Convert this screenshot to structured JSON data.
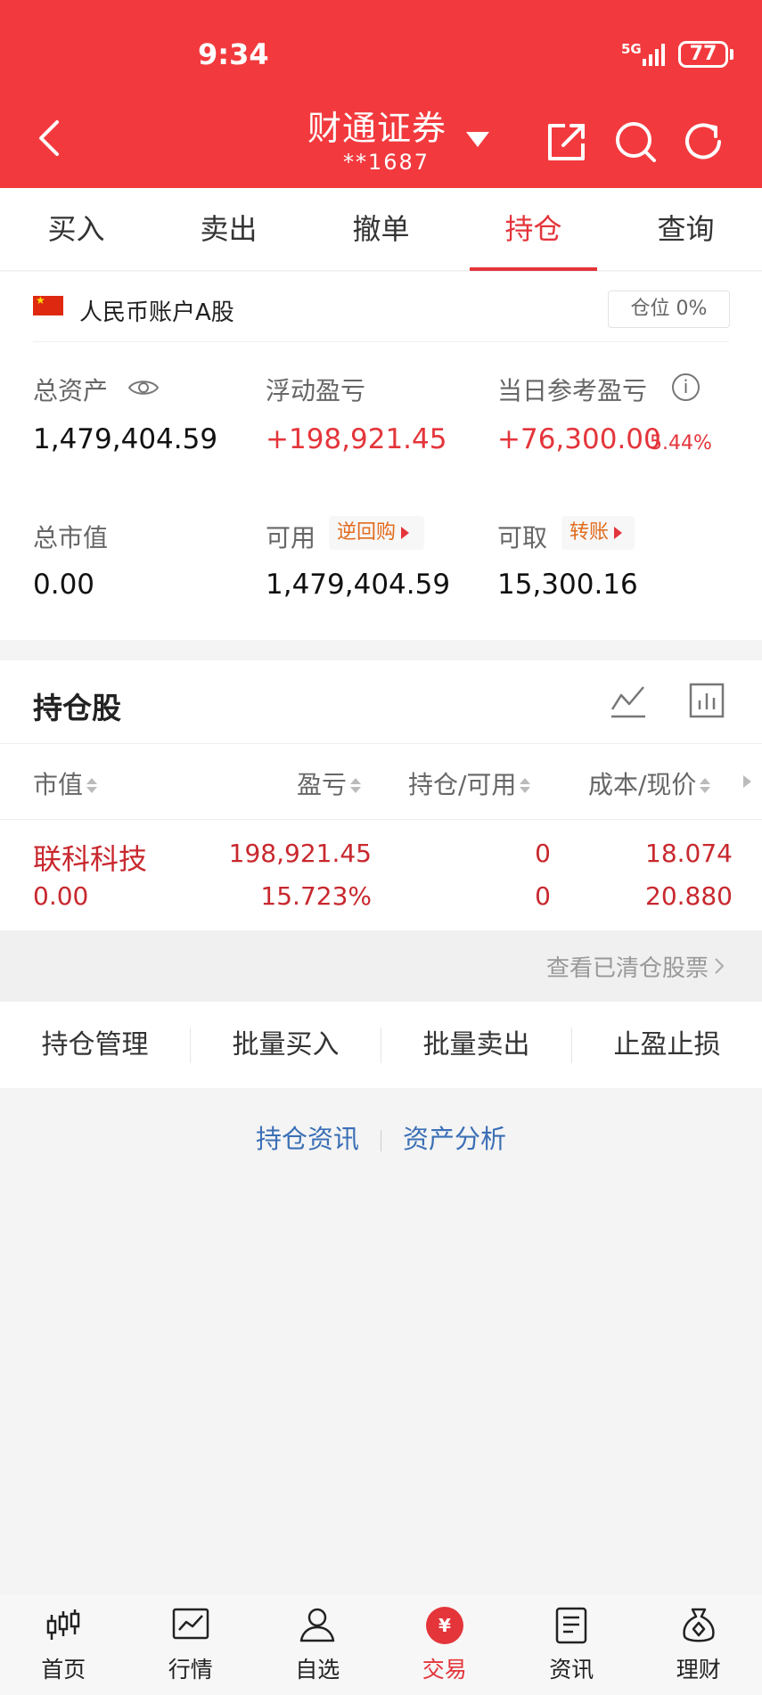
{
  "status_bar": {
    "time": "9:34",
    "network": "5G",
    "battery": "77"
  },
  "header": {
    "broker": "财通证券",
    "account": "**1687"
  },
  "tabs": [
    {
      "label": "买入",
      "active": false
    },
    {
      "label": "卖出",
      "active": false
    },
    {
      "label": "撤单",
      "active": false
    },
    {
      "label": "持仓",
      "active": true
    },
    {
      "label": "查询",
      "active": false
    }
  ],
  "account": {
    "type": "人民币账户A股",
    "position_ratio": "仓位 0%",
    "total_assets_label": "总资产",
    "total_assets": "1,479,404.59",
    "floating_pl_label": "浮动盈亏",
    "floating_pl": "+198,921.45",
    "daily_pl_label": "当日参考盈亏",
    "daily_pl": "+76,300.00",
    "daily_pl_pct": "5.44%",
    "market_value_label": "总市值",
    "market_value": "0.00",
    "available_label": "可用",
    "available_pill": "逆回购",
    "available": "1,479,404.59",
    "withdrawable_label": "可取",
    "withdrawable_pill": "转账",
    "withdrawable": "15,300.16"
  },
  "holdings": {
    "title": "持仓股",
    "columns": [
      "市值",
      "盈亏",
      "持仓/可用",
      "成本/现价"
    ],
    "rows": [
      {
        "name": "联科科技",
        "market_value": "0.00",
        "pl": "198,921.45",
        "pl_pct": "15.723%",
        "position": "0",
        "available": "0",
        "cost": "18.074",
        "price": "20.880"
      }
    ],
    "cleared_link": "查看已清仓股票"
  },
  "actions": [
    "持仓管理",
    "批量买入",
    "批量卖出",
    "止盈止损"
  ],
  "links": [
    "持仓资讯",
    "资产分析"
  ],
  "bottom_nav": [
    {
      "label": "首页",
      "icon": "candlestick-icon"
    },
    {
      "label": "行情",
      "icon": "trend-chart-icon"
    },
    {
      "label": "自选",
      "icon": "user-icon"
    },
    {
      "label": "交易",
      "icon": "yuan-icon",
      "active": true
    },
    {
      "label": "资讯",
      "icon": "document-icon"
    },
    {
      "label": "理财",
      "icon": "money-bag-icon"
    }
  ],
  "colors": {
    "brand_red": "#f23a3e",
    "gain_red": "#e4353b",
    "link_blue": "#3b6fb6",
    "pill_orange": "#e26b1d"
  }
}
